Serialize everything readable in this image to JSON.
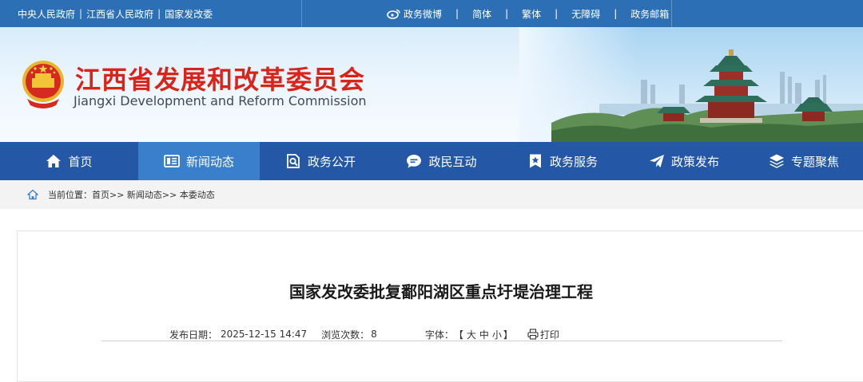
{
  "topbar": {
    "gov_links": [
      "中央人民政府",
      "江西省人民政府",
      "国家发改委"
    ],
    "right_links": [
      {
        "label": "政务微博",
        "icon": "weibo-icon"
      },
      {
        "label": "简体"
      },
      {
        "label": "繁体"
      },
      {
        "label": "无障碍"
      },
      {
        "label": "政务邮箱"
      }
    ]
  },
  "header": {
    "title": "江西省发展和改革委员会",
    "subtitle": "Jiangxi Development and Reform Commission",
    "title_color": "#d8251c"
  },
  "nav": {
    "items": [
      {
        "label": "首页",
        "icon": "home-icon"
      },
      {
        "label": "新闻动态",
        "icon": "news-icon",
        "active": true
      },
      {
        "label": "政务公开",
        "icon": "search-doc-icon"
      },
      {
        "label": "政民互动",
        "icon": "chat-icon"
      },
      {
        "label": "政务服务",
        "icon": "badge-icon"
      },
      {
        "label": "政策发布",
        "icon": "send-icon"
      },
      {
        "label": "专题聚焦",
        "icon": "layers-icon"
      }
    ],
    "bg_color": "#2457a6",
    "active_color": "#3a7fcb"
  },
  "breadcrumb": {
    "text": "当前位置：首页>> 新闻动态>> 本委动态"
  },
  "article": {
    "title": "国家发改委批复鄱阳湖区重点圩堤治理工程",
    "publish_label": "发布日期：",
    "publish_date": "2025-12-15 14:47",
    "views_label": "浏览次数：",
    "views": "8",
    "font_label": "字体：",
    "font_bracket_open": "【",
    "font_large": "大",
    "font_medium": "中",
    "font_small": "小",
    "font_bracket_close": "】",
    "print_label": "打印"
  }
}
